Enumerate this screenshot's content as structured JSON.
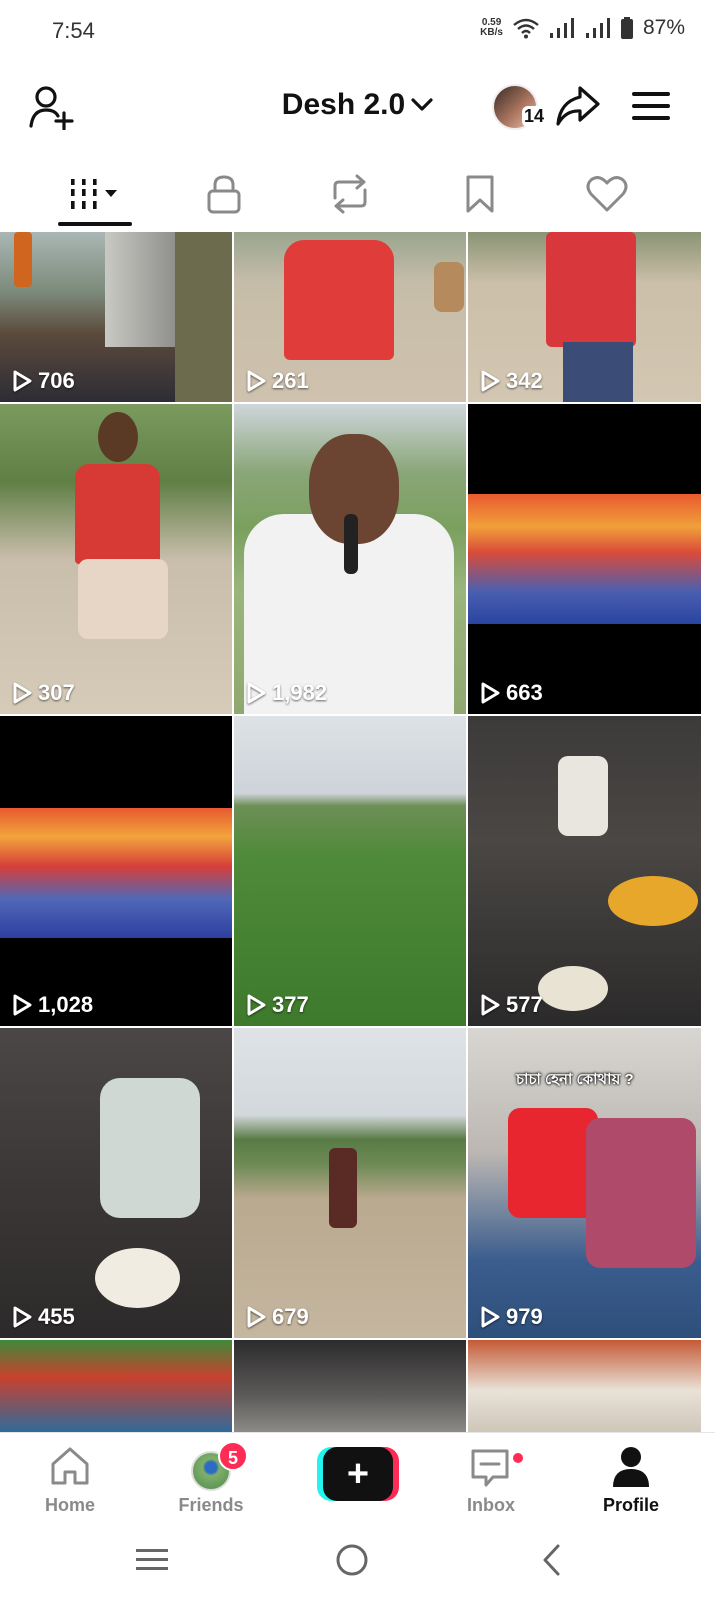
{
  "status_bar": {
    "time": "7:54",
    "net_speed_value": "0.59",
    "net_speed_unit": "KB/s",
    "battery": "87%"
  },
  "header": {
    "account_name": "Desh 2.0",
    "story_count": "14",
    "icons": [
      "add-friend-icon",
      "chevron-down-icon",
      "share-arrow-icon",
      "hamburger-menu-icon"
    ]
  },
  "tabs": [
    {
      "name": "videos",
      "icon": "grid-bars-icon",
      "active": true
    },
    {
      "name": "private",
      "icon": "lock-icon",
      "active": false
    },
    {
      "name": "reposts",
      "icon": "repost-icon",
      "active": false
    },
    {
      "name": "favorites",
      "icon": "bookmark-icon",
      "active": false
    },
    {
      "name": "liked",
      "icon": "heart-icon",
      "active": false
    }
  ],
  "videos": [
    {
      "views": "706"
    },
    {
      "views": "261"
    },
    {
      "views": "342"
    },
    {
      "views": "307"
    },
    {
      "views": "1,982"
    },
    {
      "views": "663"
    },
    {
      "views": "1,028"
    },
    {
      "views": "377"
    },
    {
      "views": "577"
    },
    {
      "views": "455"
    },
    {
      "views": "679"
    },
    {
      "views": "979",
      "overlay_text": "চাচা হেনা কোথায় ?"
    }
  ],
  "bottom_nav": {
    "home": "Home",
    "friends": "Friends",
    "friends_badge": "5",
    "create_symbol": "+",
    "inbox": "Inbox",
    "profile": "Profile"
  },
  "colors": {
    "accent_red": "#fe2c55",
    "accent_cyan": "#25f4ee",
    "inactive_gray": "#8a8a8a"
  }
}
